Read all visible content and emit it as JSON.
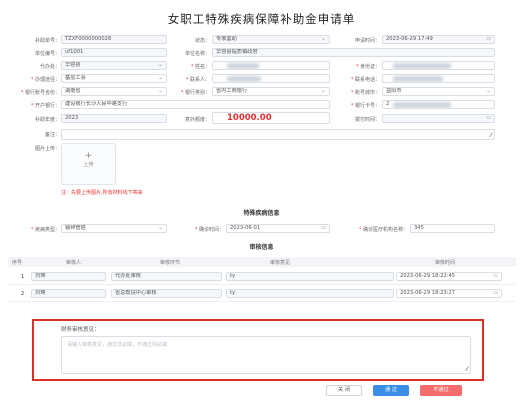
{
  "title": "女职工特殊疾病保障补助金申请单",
  "fields": {
    "apply_no_label": "补助单号：",
    "apply_no": "TZXF0000000028",
    "status_label": "状态：",
    "status": "专家鉴助",
    "apply_time_label": "申请时间：",
    "apply_time": "2023-06-29 17:49",
    "unit_code_label": "单位编号：",
    "unit_code": "uf1001",
    "unit_name_label": "单位名称：",
    "unit_name": "华容县提质镇政府",
    "proxy_label": "代办处：",
    "proxy": "华容县",
    "name_label": "姓名：",
    "id_card_label": "身份证：",
    "handle_label": "办理途径：",
    "handle": "基层工会",
    "contact_label": "联系人：",
    "contact_phone_label": "联系电话：",
    "bank_province_label": "银行账号省份：",
    "bank_province": "湖南省",
    "bank_type_label": "银行类别：",
    "bank_type": "省内工商银行",
    "account_city_label": "账号城市：",
    "account_city": "益阳市",
    "bank_branch_label": "开户银行：",
    "bank_branch": "建设银行长沙人民中路支行",
    "bank_account_label": "银行卡号：",
    "bank_account": "2",
    "subsidy_year_label": "补助年度：",
    "subsidy_year": "2023",
    "subsidy_amount_label": "意外额度：",
    "subsidy_amount": "10000.00",
    "pay_time_label": "拨付时间：",
    "remark_label": "备注：",
    "upload_label": "图片上传：",
    "upload_plus": "+",
    "upload_text": "上传",
    "notice": "注：先要上传图片,所有材料线下寄来"
  },
  "disease": {
    "section_title": "特殊疾病信息",
    "disease_type_label": "疾病类型：",
    "disease_type": "输卵管癌",
    "diagnosis_time_label": "确诊时间：",
    "diagnosis_time": "2023-06-01",
    "hospital_label": "确诊医疗机构名称：",
    "hospital": "345"
  },
  "review": {
    "section_title": "审核信息",
    "columns": [
      "序号",
      "审核人",
      "审核环节",
      "审核意见",
      "审核时间"
    ],
    "rows": [
      {
        "no": "1",
        "reviewer": "刘瑛",
        "stage": "代办处审核",
        "opinion": "ty",
        "time": "2023-06-29 18:22:45"
      },
      {
        "no": "2",
        "reviewer": "刘瑛",
        "stage": "省总帮扶中心审核",
        "opinion": "ty",
        "time": "2023-06-29 18:23:27"
      }
    ]
  },
  "finance": {
    "label": "财务审核意见：",
    "placeholder": "请输入审核意见，通过非必填，不通过则必填"
  },
  "buttons": {
    "close": "关 闭",
    "pass": "通 过",
    "reject": "不通过"
  },
  "colors": {
    "primary": "#3a8ee6",
    "danger": "#f56c6c",
    "highlight_border": "#d9302a",
    "amount": "#e03030"
  }
}
